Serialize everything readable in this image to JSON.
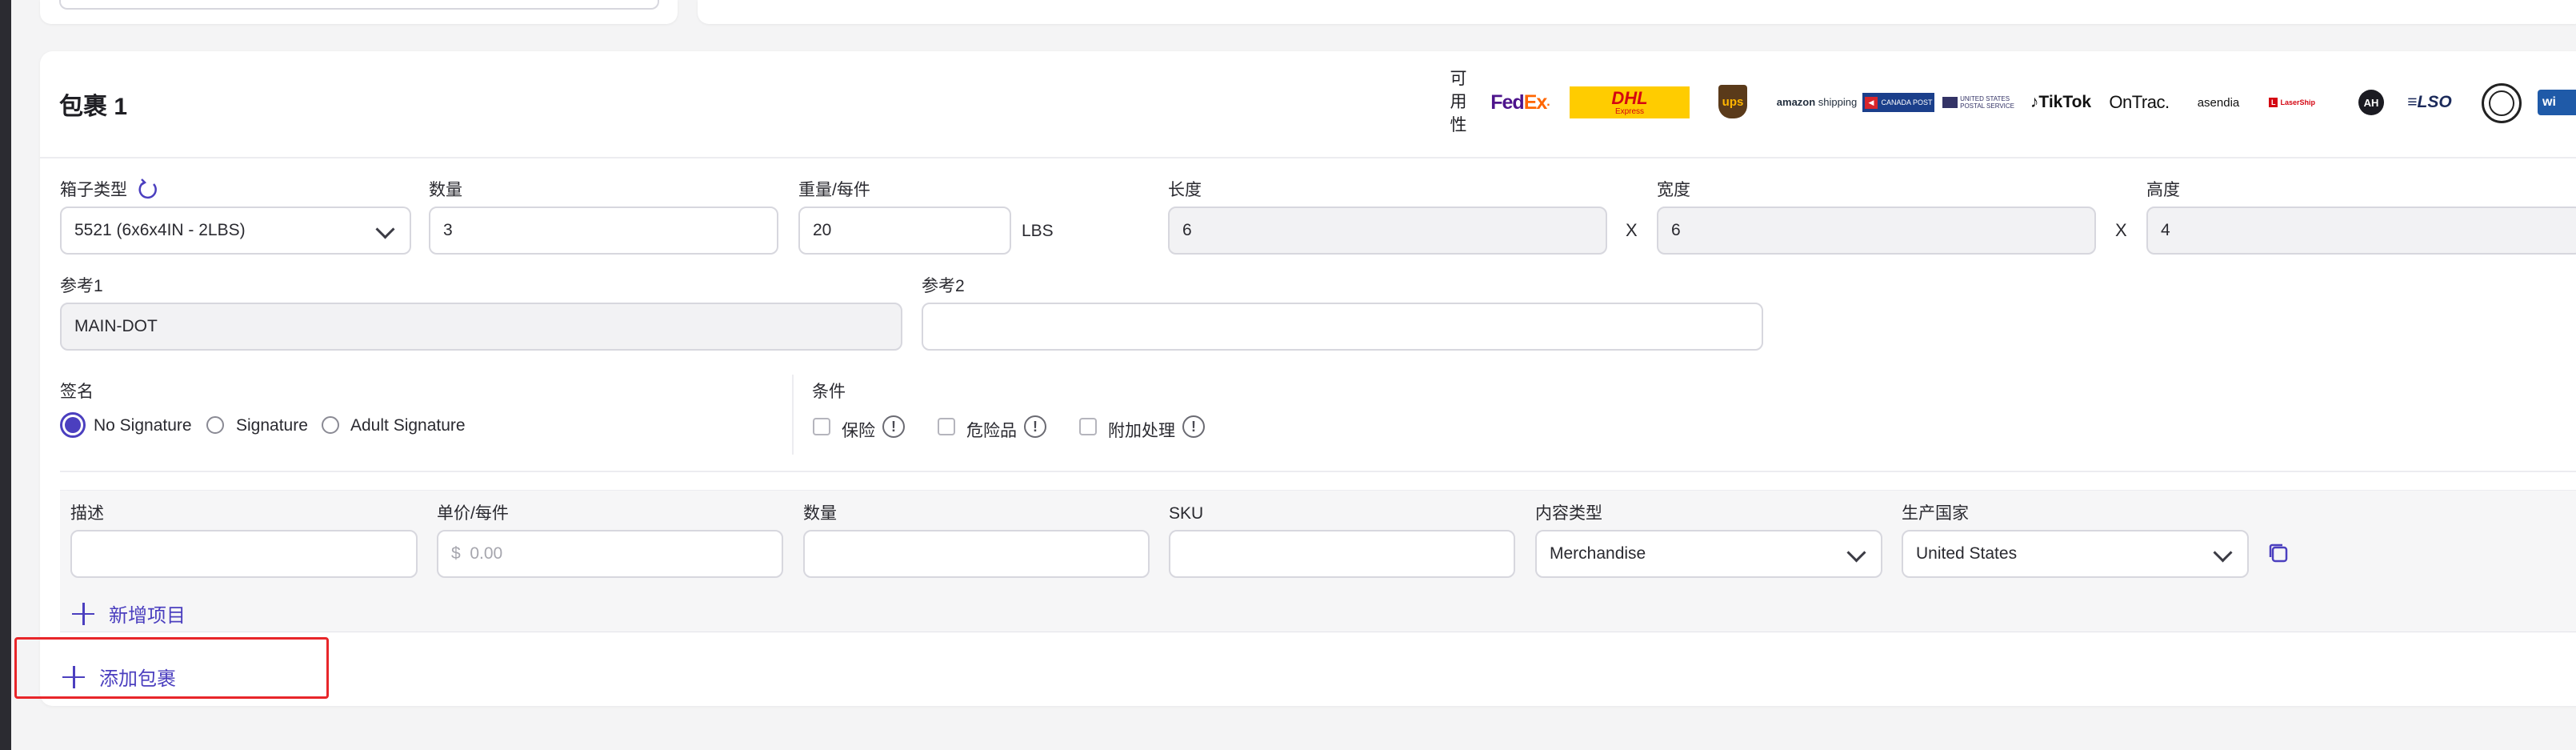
{
  "package": {
    "title": "包裹 1",
    "availability_label": "可用性",
    "carriers": [
      {
        "name": "FedEx",
        "icon": "fedex-logo"
      },
      {
        "name": "DHL Express",
        "icon": "dhl-logo"
      },
      {
        "name": "ups",
        "icon": "ups-logo"
      },
      {
        "name": "amazon shipping",
        "icon": "amazon-shipping-logo"
      },
      {
        "name": "Canada Post",
        "icon": "canada-post-logo"
      },
      {
        "name": "UNITED STATES POSTAL SERVICE",
        "icon": "usps-logo"
      },
      {
        "name": "TikTok",
        "icon": "tiktok-logo"
      },
      {
        "name": "OnTrac.",
        "icon": "ontrac-logo"
      },
      {
        "name": "asendia",
        "icon": "asendia-logo"
      },
      {
        "name": "LaserShip",
        "icon": "lasership-logo"
      },
      {
        "name": "AH",
        "icon": "ah-logo"
      },
      {
        "name": "LSO",
        "icon": "lso-logo"
      },
      {
        "name": "seal",
        "icon": "round-seal-logo"
      },
      {
        "name": "wi",
        "icon": "partial-carrier-logo"
      }
    ],
    "box_type": {
      "label": "箱子类型",
      "value": "5521 (6x6x4IN - 2LBS)"
    },
    "quantity": {
      "label": "数量",
      "value": "3"
    },
    "weight": {
      "label": "重量/每件",
      "value": "20",
      "unit": "LBS"
    },
    "length": {
      "label": "长度",
      "value": "6"
    },
    "width": {
      "label": "宽度",
      "value": "6"
    },
    "height": {
      "label": "高度",
      "value": "4"
    },
    "times_symbol": "X",
    "reference1": {
      "label": "参考1",
      "value": "MAIN-DOT"
    },
    "reference2": {
      "label": "参考2",
      "value": ""
    },
    "signature": {
      "label": "签名",
      "selected": "No Signature",
      "options": [
        "No Signature",
        "Signature",
        "Adult Signature"
      ]
    },
    "conditions": {
      "label": "条件",
      "options": [
        "保险",
        "危险品",
        "附加处理"
      ],
      "info_symbol": "!"
    },
    "item": {
      "description": {
        "label": "描述",
        "value": ""
      },
      "unit_price": {
        "label": "单价/每件",
        "currency": "$",
        "placeholder": "0.00"
      },
      "quantity": {
        "label": "数量",
        "value": ""
      },
      "sku": {
        "label": "SKU",
        "value": ""
      },
      "content_type": {
        "label": "内容类型",
        "value": "Merchandise"
      },
      "origin_country": {
        "label": "生产国家",
        "value": "United States"
      }
    },
    "add_item_label": "新增项目"
  },
  "add_package_label": "添加包裹",
  "colors": {
    "accent": "#4b3fbf",
    "highlight": "#e8262a",
    "dhl_yellow": "#ffcc00",
    "dhl_red": "#d40511",
    "fedex_purple": "#4d148c",
    "fedex_orange": "#ff6600"
  }
}
